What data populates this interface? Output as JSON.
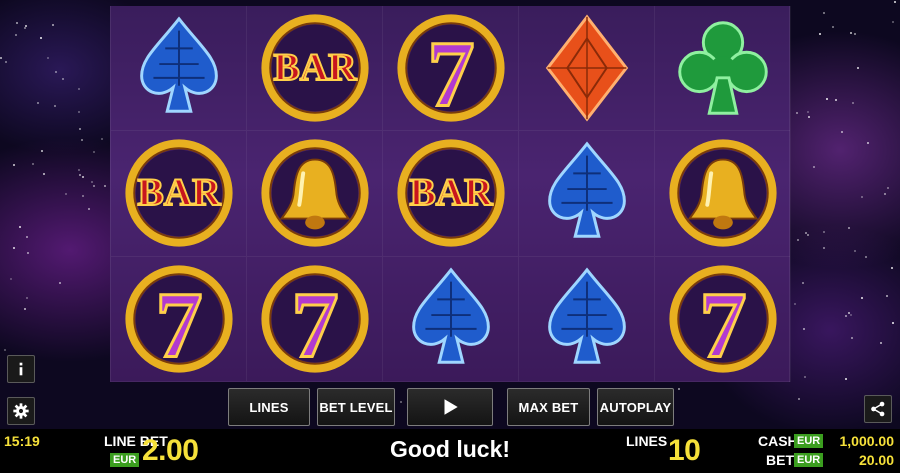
{
  "reels": [
    [
      "spade",
      "bar",
      "seven",
      "diamond",
      "club"
    ],
    [
      "bar",
      "bell",
      "bar",
      "spade",
      "bell"
    ],
    [
      "seven",
      "seven",
      "spade",
      "spade",
      "seven"
    ]
  ],
  "symbol_labels": {
    "bar": "BAR",
    "seven": "7"
  },
  "colors": {
    "accent_yellow": "#f6e13a",
    "currency_green": "#3b9e1f",
    "reel_bg": "#3a1d5c",
    "spade_blue": "#1f5ccc",
    "diamond_orange": "#e8501a",
    "club_green": "#1f9a3c",
    "gold": "#e8b020",
    "bar_red": "#c8161e",
    "seven_purple": "#b23ad0"
  },
  "side_buttons": {
    "info_icon": "info-icon",
    "settings_icon": "gear-icon",
    "share_icon": "share-icon"
  },
  "controls": {
    "lines_label": "LINES",
    "bet_level_label": "BET LEVEL",
    "spin_icon": "play-icon",
    "max_bet_label": "MAX BET",
    "autoplay_label": "AUTOPLAY"
  },
  "status_bar": {
    "clock": "15:19",
    "line_bet_label": "LINE BET",
    "line_bet_currency": "EUR",
    "line_bet_value": "2.00",
    "message": "Good luck!",
    "lines_label": "LINES",
    "lines_value": "10",
    "cash_label": "CASH",
    "cash_currency": "EUR",
    "cash_value": "1,000.00",
    "bet_label": "BET",
    "bet_currency": "EUR",
    "bet_value": "20.00"
  }
}
